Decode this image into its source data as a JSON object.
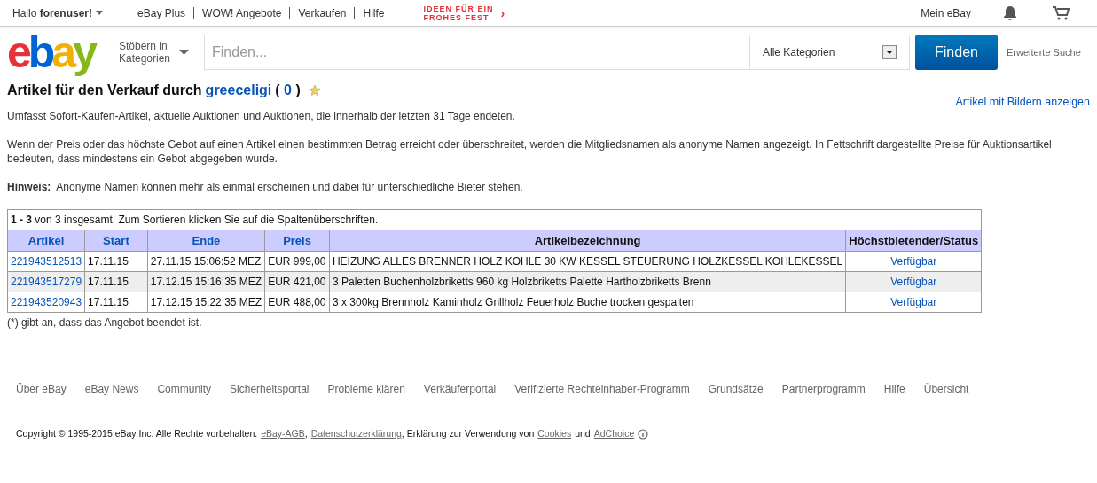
{
  "top_bar": {
    "greeting": "Hallo **forenuser!**",
    "links": [
      "eBay Plus",
      "WOW! Angebote",
      "Verkaufen",
      "Hilfe"
    ],
    "promo": [
      "IDEEN FÜR EIN",
      "FROHES FEST"
    ],
    "promo_arrow": "›",
    "my_ebay": "Mein eBay"
  },
  "header": {
    "logo": [
      {
        "char": "e",
        "color": "#e53238"
      },
      {
        "char": "b",
        "color": "#0064d2"
      },
      {
        "char": "a",
        "color": "#f5af02"
      },
      {
        "char": "y",
        "color": "#86b817"
      }
    ],
    "browse": "Stöbern in Kategorien",
    "search": {
      "placeholder": "Finden..."
    },
    "category": "Alle Kategorien",
    "search_button": "Finden",
    "advanced": "Erweiterte Suche"
  },
  "title": {
    "prefix": "Artikel für den Verkauf durch",
    "seller": "greeceligi",
    "open": "(",
    "score": "0",
    "close": ")"
  },
  "show_pictures": "Artikel mit Bildern anzeigen",
  "paragraphs": [
    "Umfasst Sofort-Kaufen-Artikel, aktuelle Auktionen und Auktionen, die innerhalb der letzten 31 Tage endeten.",
    "Wenn der Preis oder das höchste Gebot auf einen Artikel einen bestimmten Betrag erreicht oder überschreitet, werden die Mitgliedsnamen als anonyme Namen angezeigt. In Fettschrift dargestellte Preise für Auktionsartikel bedeuten, dass mindestens ein Gebot abgegeben wurde.",
    "**Hinweis:**  Anonyme Namen können mehr als einmal erscheinen und dabei für unterschiedliche Bieter stehen."
  ],
  "table": {
    "summary": "**1 - 3** von 3 insgesamt. Zum Sortieren klicken Sie auf die Spaltenüberschriften.",
    "columns": [
      {
        "label": "Artikel",
        "sortable": true
      },
      {
        "label": "Start",
        "sortable": true
      },
      {
        "label": "Ende",
        "sortable": true
      },
      {
        "label": "Preis",
        "sortable": true
      },
      {
        "label": "Artikelbezeichnung",
        "sortable": false
      },
      {
        "label": "Höchstbietender/Status",
        "sortable": false
      }
    ],
    "rows": [
      {
        "id": "221943512513",
        "start": "17.11.15",
        "end": "27.11.15 15:06:52 MEZ",
        "price": "EUR 999,00",
        "title": "HEIZUNG ALLES BRENNER HOLZ KOHLE 30 KW KESSEL STEUERUNG HOLZKESSEL KOHLEKESSEL",
        "status": "Verfügbar"
      },
      {
        "id": "221943517279",
        "start": "17.11.15",
        "end": "17.12.15 15:16:35 MEZ",
        "price": "EUR 421,00",
        "title": "3 Paletten Buchenholzbriketts 960 kg Holzbriketts Palette Hartholzbriketts Brenn",
        "status": "Verfügbar"
      },
      {
        "id": "221943520943",
        "start": "17.11.15",
        "end": "17.12.15 15:22:35 MEZ",
        "price": "EUR 488,00",
        "title": "3 x 300kg Brennholz Kaminholz Grillholz Feuerholz Buche trocken gespalten",
        "status": "Verfügbar"
      }
    ],
    "footnote": "(*) gibt an, dass das Angebot beendet ist."
  },
  "footer": {
    "links": [
      "Über eBay",
      "eBay News",
      "Community",
      "Sicherheitsportal",
      "Probleme klären",
      "Verkäuferportal",
      "Verifizierte Rechteinhaber-Programm",
      "Grundsätze",
      "Partnerprogramm",
      "Hilfe",
      "Übersicht"
    ],
    "copyright": "Copyright © 1995-2015 eBay Inc. Alle Rechte vorbehalten.",
    "agb": "eBay-AGB",
    "comma": ",",
    "privacy": "Datenschutzerklärung",
    "cookies_text": ", Erklärung zur Verwendung von",
    "cookies": "Cookies",
    "and": "und",
    "adchoice": "AdChoice"
  }
}
